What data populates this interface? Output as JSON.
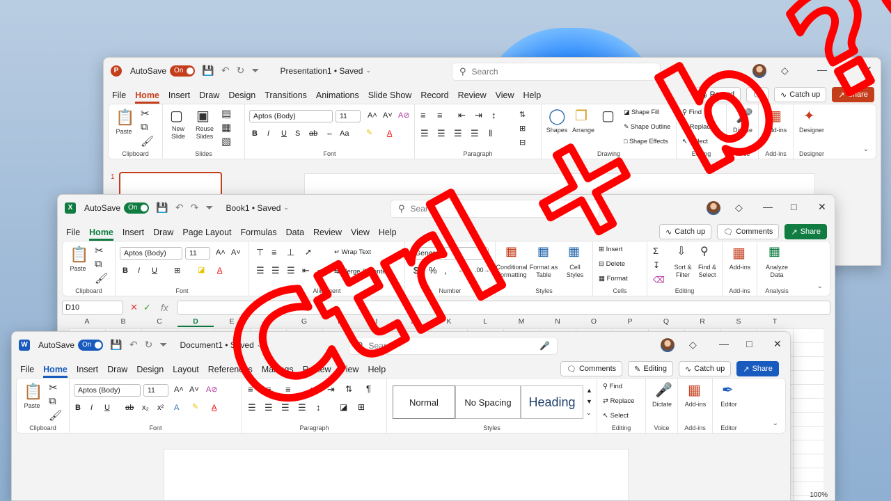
{
  "colors": {
    "powerpoint": "#c43e1c",
    "excel": "#107c41",
    "word": "#185abd",
    "ink": "#ff0000"
  },
  "powerpoint": {
    "autosave_label": "AutoSave",
    "autosave_state": "On",
    "doc_title": "Presentation1 • Saved",
    "search_placeholder": "Search",
    "tabs": [
      "File",
      "Home",
      "Insert",
      "Draw",
      "Design",
      "Transitions",
      "Animations",
      "Slide Show",
      "Record",
      "Review",
      "View",
      "Help"
    ],
    "commands": {
      "record": "Record",
      "catch_up": "Catch up",
      "share": "Share"
    },
    "ribbon": {
      "paste": "Paste",
      "clipboard": "Clipboard",
      "new_slide": "New Slide",
      "reuse_slides": "Reuse Slides",
      "slides": "Slides",
      "font_name": "Aptos (Body)",
      "font_size": "11",
      "font": "Font",
      "paragraph": "Paragraph",
      "shapes": "Shapes",
      "arrange": "Arrange",
      "drawing": "Drawing",
      "shape_fill": "Shape Fill",
      "shape_outline": "Shape Outline",
      "shape_effects": "Shape Effects",
      "find": "Find",
      "replace": "Replace",
      "select": "Select",
      "editing": "Editing",
      "dictate": "Dictate",
      "voice": "Voice",
      "add_ins": "Add-ins",
      "add_ins_group": "Add-ins",
      "designer": "Designer",
      "designer_group": "Designer"
    },
    "slide_number": "1"
  },
  "excel": {
    "autosave_label": "AutoSave",
    "autosave_state": "On",
    "doc_title": "Book1 • Saved",
    "search_placeholder": "Search",
    "tabs": [
      "File",
      "Home",
      "Insert",
      "Draw",
      "Page Layout",
      "Formulas",
      "Data",
      "Review",
      "View",
      "Help"
    ],
    "commands": {
      "catch_up": "Catch up",
      "comments": "Comments",
      "share": "Share"
    },
    "ribbon": {
      "paste": "Paste",
      "clipboard": "Clipboard",
      "font_name": "Aptos (Body)",
      "font_size": "11",
      "font": "Font",
      "wrap_text": "Wrap Text",
      "merge_center": "Merge & Center",
      "alignment": "Alignment",
      "number_format": "General",
      "number": "Number",
      "conditional_formatting": "Conditional Formatting",
      "format_as_table": "Format as Table",
      "cell_styles": "Cell Styles",
      "styles": "Styles",
      "insert": "Insert",
      "delete": "Delete",
      "format": "Format",
      "cells": "Cells",
      "sort_filter": "Sort & Filter",
      "find_select": "Find & Select",
      "editing": "Editing",
      "add_ins": "Add-ins",
      "add_ins_group": "Add-ins",
      "analyze_data": "Analyze Data",
      "analysis": "Analysis"
    },
    "name_box": "D10",
    "columns": [
      "A",
      "B",
      "C",
      "D",
      "E",
      "F",
      "G",
      "H",
      "I",
      "J",
      "K",
      "L",
      "M",
      "N",
      "O",
      "P",
      "Q",
      "R",
      "S",
      "T"
    ],
    "zoom": "100%"
  },
  "word": {
    "autosave_label": "AutoSave",
    "autosave_state": "On",
    "doc_title": "Document1 • Saved",
    "search_placeholder": "Search",
    "tabs": [
      "File",
      "Home",
      "Insert",
      "Draw",
      "Design",
      "Layout",
      "References",
      "Mailings",
      "Review",
      "View",
      "Help"
    ],
    "commands": {
      "comments": "Comments",
      "editing": "Editing",
      "catch_up": "Catch up",
      "share": "Share"
    },
    "ribbon": {
      "paste": "Paste",
      "clipboard": "Clipboard",
      "font_name": "Aptos (Body)",
      "font_size": "11",
      "font": "Font",
      "paragraph": "Paragraph",
      "style_normal": "Normal",
      "style_no_spacing": "No Spacing",
      "style_heading": "Heading",
      "styles": "Styles",
      "find": "Find",
      "replace": "Replace",
      "select": "Select",
      "editing": "Editing",
      "dictate": "Dictate",
      "voice": "Voice",
      "add_ins": "Add-ins",
      "add_ins_group": "Add-ins",
      "editor": "Editor",
      "editor_group": "Editor"
    }
  },
  "annotation": {
    "text": "Ctrl + b ?!"
  }
}
